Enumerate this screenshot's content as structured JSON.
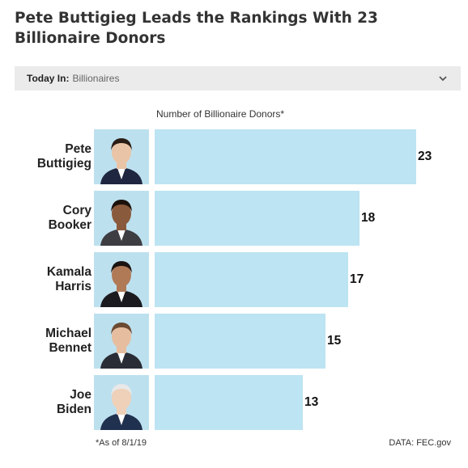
{
  "headline": "Pete Buttigieg Leads the Rankings With 23 Billionaire Donors",
  "topic_bar": {
    "label": "Today In:",
    "value": "Billionaires",
    "icon": "chevron-down-icon"
  },
  "chart_data": {
    "type": "bar",
    "orientation": "horizontal",
    "xlabel": "Number of Billionaire Donors*",
    "categories": [
      [
        "Pete",
        "Buttigieg"
      ],
      [
        "Cory",
        "Booker"
      ],
      [
        "Kamala",
        "Harris"
      ],
      [
        "Michael",
        "Bennet"
      ],
      [
        "Joe",
        "Biden"
      ]
    ],
    "values": [
      23,
      18,
      17,
      15,
      13
    ],
    "bar_color": "#bde4f2",
    "data_labels": true,
    "grid": false
  },
  "footnote": "*As of 8/1/19",
  "source": "DATA: FEC.gov"
}
